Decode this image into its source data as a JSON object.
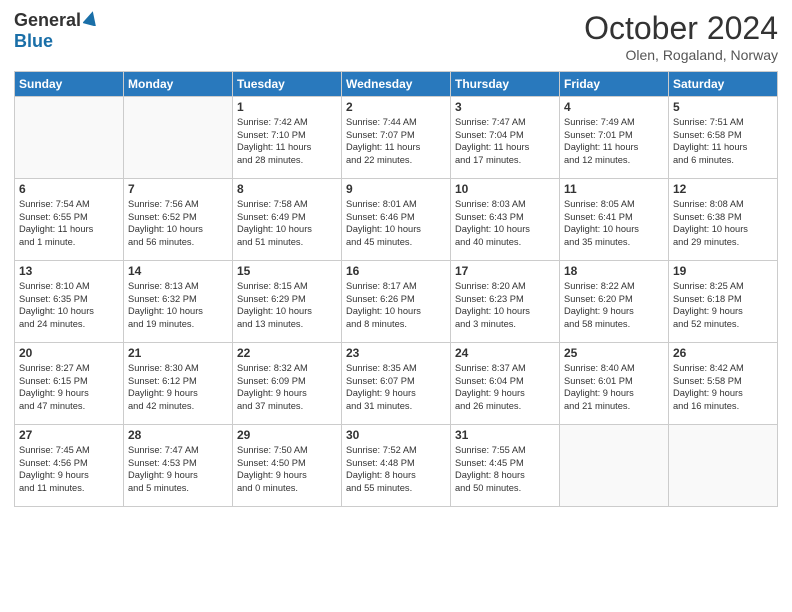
{
  "header": {
    "logo_general": "General",
    "logo_blue": "Blue",
    "month_title": "October 2024",
    "location": "Olen, Rogaland, Norway"
  },
  "weekdays": [
    "Sunday",
    "Monday",
    "Tuesday",
    "Wednesday",
    "Thursday",
    "Friday",
    "Saturday"
  ],
  "weeks": [
    [
      {
        "day": "",
        "content": ""
      },
      {
        "day": "",
        "content": ""
      },
      {
        "day": "1",
        "content": "Sunrise: 7:42 AM\nSunset: 7:10 PM\nDaylight: 11 hours\nand 28 minutes."
      },
      {
        "day": "2",
        "content": "Sunrise: 7:44 AM\nSunset: 7:07 PM\nDaylight: 11 hours\nand 22 minutes."
      },
      {
        "day": "3",
        "content": "Sunrise: 7:47 AM\nSunset: 7:04 PM\nDaylight: 11 hours\nand 17 minutes."
      },
      {
        "day": "4",
        "content": "Sunrise: 7:49 AM\nSunset: 7:01 PM\nDaylight: 11 hours\nand 12 minutes."
      },
      {
        "day": "5",
        "content": "Sunrise: 7:51 AM\nSunset: 6:58 PM\nDaylight: 11 hours\nand 6 minutes."
      }
    ],
    [
      {
        "day": "6",
        "content": "Sunrise: 7:54 AM\nSunset: 6:55 PM\nDaylight: 11 hours\nand 1 minute."
      },
      {
        "day": "7",
        "content": "Sunrise: 7:56 AM\nSunset: 6:52 PM\nDaylight: 10 hours\nand 56 minutes."
      },
      {
        "day": "8",
        "content": "Sunrise: 7:58 AM\nSunset: 6:49 PM\nDaylight: 10 hours\nand 51 minutes."
      },
      {
        "day": "9",
        "content": "Sunrise: 8:01 AM\nSunset: 6:46 PM\nDaylight: 10 hours\nand 45 minutes."
      },
      {
        "day": "10",
        "content": "Sunrise: 8:03 AM\nSunset: 6:43 PM\nDaylight: 10 hours\nand 40 minutes."
      },
      {
        "day": "11",
        "content": "Sunrise: 8:05 AM\nSunset: 6:41 PM\nDaylight: 10 hours\nand 35 minutes."
      },
      {
        "day": "12",
        "content": "Sunrise: 8:08 AM\nSunset: 6:38 PM\nDaylight: 10 hours\nand 29 minutes."
      }
    ],
    [
      {
        "day": "13",
        "content": "Sunrise: 8:10 AM\nSunset: 6:35 PM\nDaylight: 10 hours\nand 24 minutes."
      },
      {
        "day": "14",
        "content": "Sunrise: 8:13 AM\nSunset: 6:32 PM\nDaylight: 10 hours\nand 19 minutes."
      },
      {
        "day": "15",
        "content": "Sunrise: 8:15 AM\nSunset: 6:29 PM\nDaylight: 10 hours\nand 13 minutes."
      },
      {
        "day": "16",
        "content": "Sunrise: 8:17 AM\nSunset: 6:26 PM\nDaylight: 10 hours\nand 8 minutes."
      },
      {
        "day": "17",
        "content": "Sunrise: 8:20 AM\nSunset: 6:23 PM\nDaylight: 10 hours\nand 3 minutes."
      },
      {
        "day": "18",
        "content": "Sunrise: 8:22 AM\nSunset: 6:20 PM\nDaylight: 9 hours\nand 58 minutes."
      },
      {
        "day": "19",
        "content": "Sunrise: 8:25 AM\nSunset: 6:18 PM\nDaylight: 9 hours\nand 52 minutes."
      }
    ],
    [
      {
        "day": "20",
        "content": "Sunrise: 8:27 AM\nSunset: 6:15 PM\nDaylight: 9 hours\nand 47 minutes."
      },
      {
        "day": "21",
        "content": "Sunrise: 8:30 AM\nSunset: 6:12 PM\nDaylight: 9 hours\nand 42 minutes."
      },
      {
        "day": "22",
        "content": "Sunrise: 8:32 AM\nSunset: 6:09 PM\nDaylight: 9 hours\nand 37 minutes."
      },
      {
        "day": "23",
        "content": "Sunrise: 8:35 AM\nSunset: 6:07 PM\nDaylight: 9 hours\nand 31 minutes."
      },
      {
        "day": "24",
        "content": "Sunrise: 8:37 AM\nSunset: 6:04 PM\nDaylight: 9 hours\nand 26 minutes."
      },
      {
        "day": "25",
        "content": "Sunrise: 8:40 AM\nSunset: 6:01 PM\nDaylight: 9 hours\nand 21 minutes."
      },
      {
        "day": "26",
        "content": "Sunrise: 8:42 AM\nSunset: 5:58 PM\nDaylight: 9 hours\nand 16 minutes."
      }
    ],
    [
      {
        "day": "27",
        "content": "Sunrise: 7:45 AM\nSunset: 4:56 PM\nDaylight: 9 hours\nand 11 minutes."
      },
      {
        "day": "28",
        "content": "Sunrise: 7:47 AM\nSunset: 4:53 PM\nDaylight: 9 hours\nand 5 minutes."
      },
      {
        "day": "29",
        "content": "Sunrise: 7:50 AM\nSunset: 4:50 PM\nDaylight: 9 hours\nand 0 minutes."
      },
      {
        "day": "30",
        "content": "Sunrise: 7:52 AM\nSunset: 4:48 PM\nDaylight: 8 hours\nand 55 minutes."
      },
      {
        "day": "31",
        "content": "Sunrise: 7:55 AM\nSunset: 4:45 PM\nDaylight: 8 hours\nand 50 minutes."
      },
      {
        "day": "",
        "content": ""
      },
      {
        "day": "",
        "content": ""
      }
    ]
  ]
}
